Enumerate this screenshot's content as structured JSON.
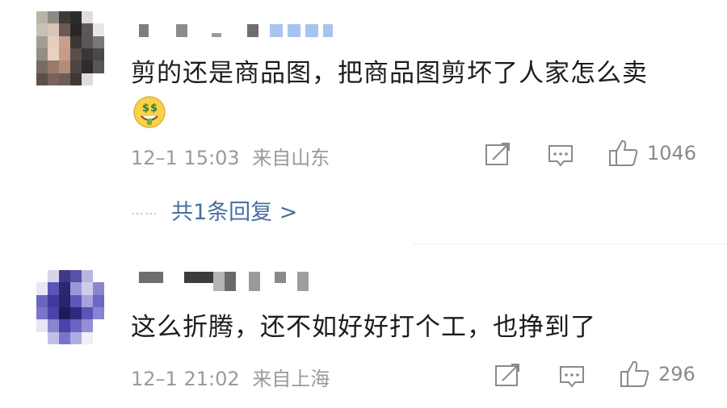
{
  "comments": [
    {
      "text": "剪的还是商品图，把商品图剪坏了人家怎么卖",
      "emoji": "money-mouth-face",
      "time": "12–1 15:03",
      "location": "来自山东",
      "likes": "1046",
      "replies_label": "共1条回复 >",
      "replies_dots": "……"
    },
    {
      "text": "这么折腾，还不如好好打个工，也挣到了",
      "time": "12–1 21:02",
      "location": "来自上海",
      "likes": "296"
    }
  ],
  "icons": {
    "share": "share-icon",
    "comment": "comment-icon",
    "like": "thumbs-up-icon"
  },
  "colors": {
    "reply_link": "#4a6ea0",
    "meta_text": "#9a9a9a",
    "name_blue": "#a6c4ef"
  }
}
